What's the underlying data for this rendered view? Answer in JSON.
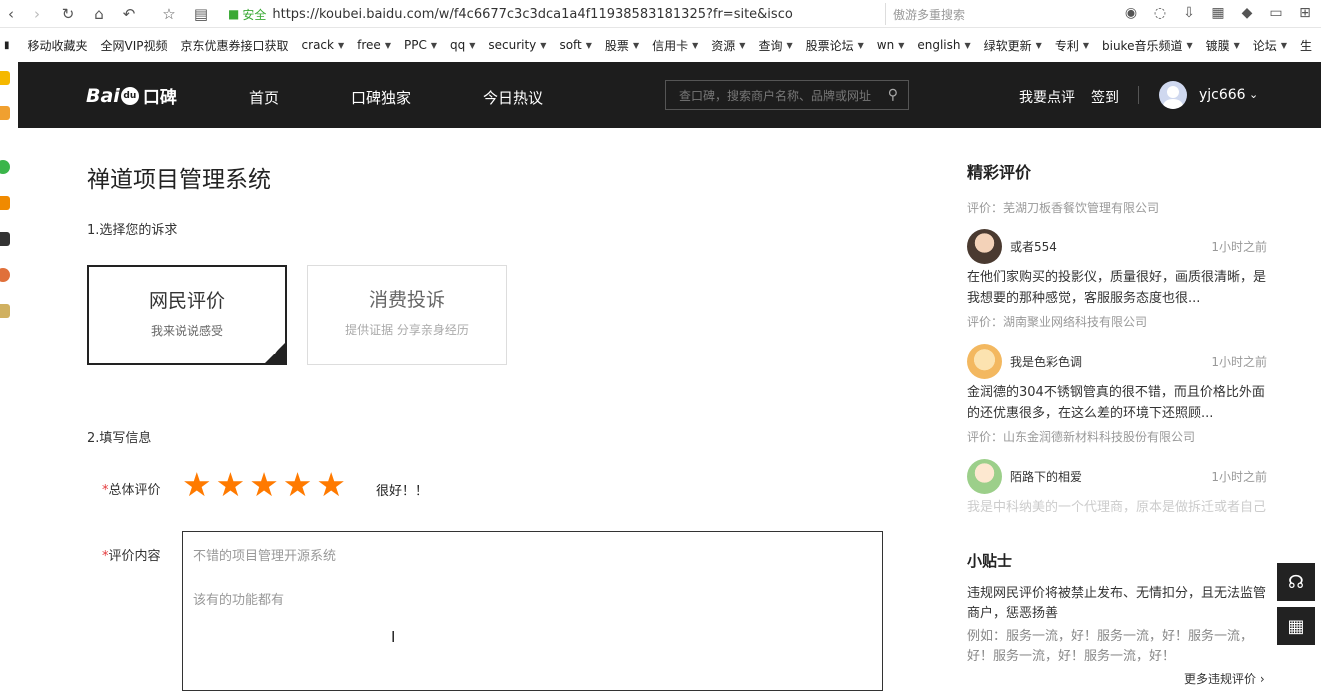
{
  "browser": {
    "secure_label": "安全",
    "url": "https://koubei.baidu.com/w/f4c6677c3c3dca1a4f11938583181325?fr=site&isco",
    "search_placeholder": "傲游多重搜索"
  },
  "bookmarks": [
    "移动收藏夹",
    "全网VIP视频",
    "京东优惠券接口获取",
    "crack",
    "free",
    "PPC",
    "qq",
    "security",
    "soft",
    "股票",
    "信用卡",
    "资源",
    "查询",
    "股票论坛",
    "wn",
    "english",
    "绿软更新",
    "专利",
    "biuke音乐频道",
    "镀膜",
    "论坛",
    "生"
  ],
  "header": {
    "logo_bai": "Bai",
    "logo_du": "du",
    "logo_kb": "口碑",
    "nav": [
      "首页",
      "口碑独家",
      "今日热议"
    ],
    "search_placeholder": "查口碑，搜索商户名称、品牌或网址",
    "write_review": "我要点评",
    "sign_in": "签到",
    "username": "yjc666"
  },
  "main": {
    "title": "禅道项目管理系统",
    "step1": "1.选择您的诉求",
    "cards": [
      {
        "title": "网民评价",
        "sub": "我来说说感受"
      },
      {
        "title": "消费投诉",
        "sub": "提供证据 分享亲身经历"
      }
    ],
    "step2": "2.填写信息",
    "rating_label": "总体评价",
    "rating_value": 5,
    "rating_max": 5,
    "rating_text": "很好！！",
    "content_label": "评价内容",
    "content_lines": [
      "不错的项目管理开源系统",
      "",
      "该有的功能都有"
    ]
  },
  "sidebar": {
    "title": "精彩评价",
    "first_company": "评价：芜湖刀板香餐饮管理有限公司",
    "reviews": [
      {
        "user": "或者554",
        "time": "1小时之前",
        "text": "在他们家购买的投影仪，质量很好，画质很清晰，是我想要的那种感觉，客服服务态度也很...",
        "company": "评价：湖南聚业网络科技有限公司"
      },
      {
        "user": "我是色彩色调",
        "time": "1小时之前",
        "text": "金润德的304不锈钢管真的很不错，而且价格比外面的还优惠很多，在这么差的环境下还照顾...",
        "company": "评价：山东金润德新材料科技股份有限公司"
      },
      {
        "user": "陌路下的相爱",
        "time": "1小时之前",
        "text": "我是中科纳美的一个代理商，原本是做拆迁或者自己",
        "company": ""
      }
    ],
    "tips_title": "小贴士",
    "tips_text": "违规网民评价将被禁止发布、无情扣分，且无法监管商户，惩恶扬善",
    "tips_example": "例如：服务一流，好！服务一流，好！服务一流，好！服务一流，好！服务一流，好！",
    "more": "更多违规评价 ›"
  }
}
